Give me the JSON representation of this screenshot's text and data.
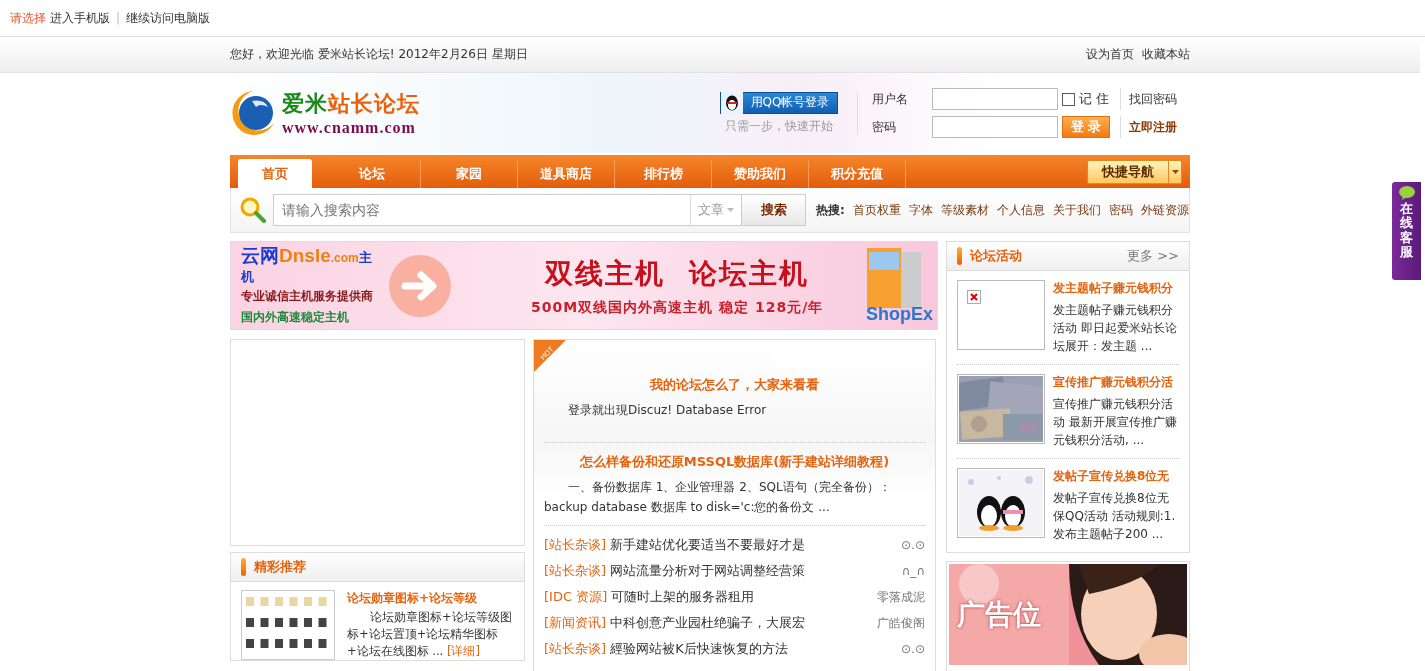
{
  "top_bar": {
    "label": "请选择",
    "links": [
      "进入手机版",
      "继续访问电脑版"
    ],
    "separator": "|"
  },
  "welcome": {
    "text": "您好，欢迎光临 爱米站长论坛! 2012年2月26日 星期日",
    "links": [
      "设为首页",
      "收藏本站"
    ]
  },
  "logo": {
    "name_green": "爱米",
    "name_orange": "站长论坛",
    "url": "www.cnamm.com"
  },
  "qq_login": {
    "button": "用QQ帐号登录",
    "hint": "只需一步，快速开始"
  },
  "login": {
    "username_label": "用户名",
    "password_label": "密码",
    "remember": {
      "label": "记 住",
      "checked": false
    },
    "submit": "登 录",
    "links": [
      "找回密码",
      "立即注册"
    ]
  },
  "nav": {
    "items": [
      {
        "label": "首页",
        "selected": true
      },
      {
        "label": "论坛",
        "selected": false
      },
      {
        "label": "家园",
        "selected": false
      },
      {
        "label": "道具商店",
        "selected": false
      },
      {
        "label": "排行榜",
        "selected": false
      },
      {
        "label": "赞助我们",
        "selected": false
      },
      {
        "label": "积分充值",
        "selected": false
      }
    ],
    "quick_nav": "快捷导航"
  },
  "search": {
    "placeholder": "请输入搜索内容",
    "scope": "文章",
    "button": "搜索",
    "hot_label": "热搜:",
    "hot": [
      "首页权重",
      "字体",
      "等级素材",
      "个人信息",
      "关于我们",
      "密码",
      "外链资源"
    ]
  },
  "banner": {
    "brand": "云网",
    "brand_domain": "Dnsle",
    "brand_tld": ".com",
    "brand_tag": "主机",
    "lines": [
      "专业诚信主机服务提供商",
      "国内外高速稳定主机"
    ],
    "headline": "双线主机  论坛主机",
    "subline": "500M双线国内外高速主机 稳定 128元/年",
    "product": "ShopEx"
  },
  "featured": {
    "title": "精彩推荐",
    "items": [
      {
        "title": "论坛勋章图标+论坛等级",
        "summary": "论坛勋章图标+论坛等级图标+论坛置顶+论坛精华图标+论坛在线图标 ...",
        "more": "[详细]"
      }
    ]
  },
  "hot_articles": {
    "badge": "HOT",
    "items": [
      {
        "title": "我的论坛怎么了，大家来看看",
        "summary": "登录就出現Discuz! Database Error"
      },
      {
        "title": "怎么样备份和还原MSSQL数据库(新手建站详细教程)",
        "summary": "一、备份数据库 1、企业管理器 2、SQL语句（完全备份）：backup database 数据库 to disk='c:您的备份文 ..."
      }
    ]
  },
  "news": [
    {
      "category": "[站长杂谈]",
      "title": "新手建站优化要适当不要最好才是",
      "author": "⊙.⊙"
    },
    {
      "category": "[站长杂谈]",
      "title": "网站流量分析对于网站调整经营策",
      "author": "∩_∩"
    },
    {
      "category": "[IDC 资源]",
      "title": "可随时上架的服务器租用",
      "author": "零落成泥"
    },
    {
      "category": "[新闻资讯]",
      "title": "中科创意产业园杜绝骗子，大展宏",
      "author": "广皓俊阁"
    },
    {
      "category": "[站长杂谈]",
      "title": "經验网站被K后快速恢复的方法",
      "author": "⊙.⊙"
    }
  ],
  "activities": {
    "title": "论坛活动",
    "more": "更多 >>",
    "items": [
      {
        "kind": "broken",
        "title": "发主题帖子赚元钱积分",
        "summary": "发主题帖子赚元钱积分活动 即日起爱米站长论坛展开：发主题 ..."
      },
      {
        "kind": "money",
        "title": "宣传推广赚元钱积分活",
        "summary": "宣传推广赚元钱积分活动 最新开展宣传推广赚元钱积分活动, ..."
      },
      {
        "kind": "penguins",
        "title": "发帖子宣传兑换8位无",
        "summary": "发帖子宣传兑换8位无保QQ活动 活动规则:1. 发布主题帖子200 ..."
      }
    ]
  },
  "ad": {
    "text": "广告位"
  },
  "service": {
    "label": "在线客服"
  }
}
